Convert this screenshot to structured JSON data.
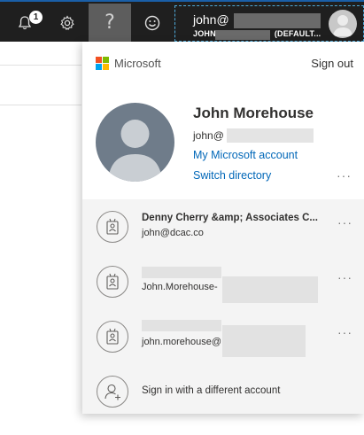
{
  "topbar": {
    "notification_count": "1",
    "help_symbol": "?",
    "account": {
      "name": "john@",
      "directory": "JOHN",
      "directory_suffix": "(DEFAULT..."
    }
  },
  "panel": {
    "brand": "Microsoft",
    "sign_out": "Sign out",
    "user": {
      "name": "John Morehouse",
      "email": "john@"
    },
    "links": {
      "my_account": "My Microsoft account",
      "switch_directory": "Switch directory"
    },
    "more_glyph": "···",
    "accounts": [
      {
        "title": "Denny Cherry &amp; Associates C...",
        "subtitle": "john@dcac.co"
      },
      {
        "title": "",
        "subtitle": "John.Morehouse-"
      },
      {
        "title": "",
        "subtitle": "john.morehouse@"
      }
    ],
    "sign_in_other": "Sign in with a different account"
  }
}
